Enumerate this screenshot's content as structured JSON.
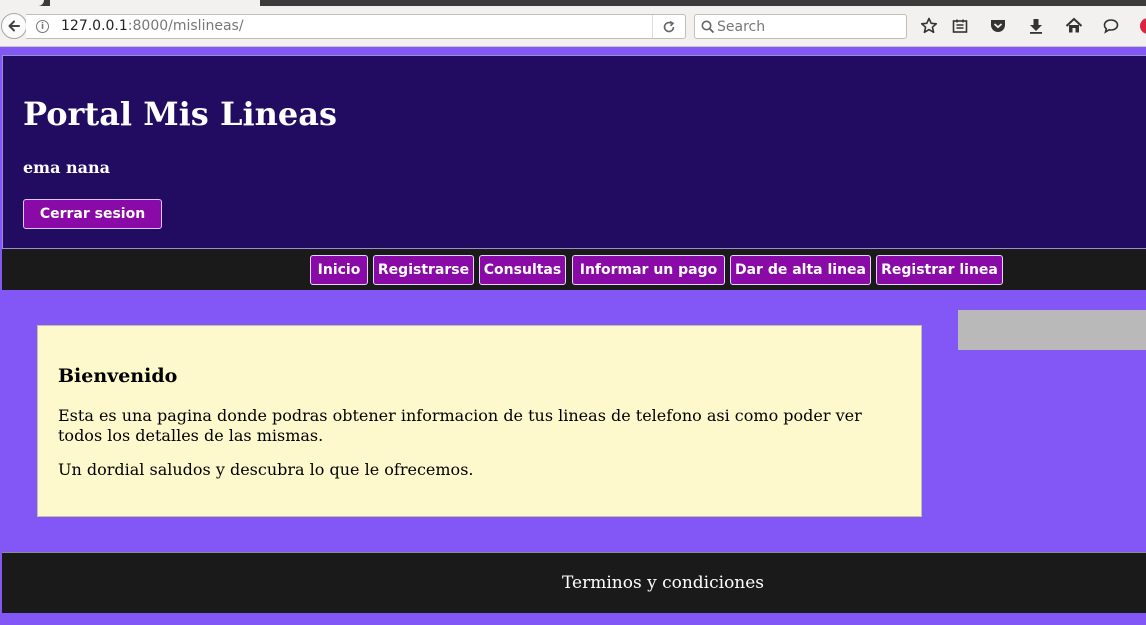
{
  "browser": {
    "url_host": "127.0.0.1",
    "url_rest": ":8000/mislineas/",
    "search_placeholder": "Search"
  },
  "header": {
    "title": "Portal Mis Lineas",
    "user": "ema nana",
    "logout_label": "Cerrar sesion"
  },
  "nav": {
    "items": [
      {
        "label": "Inicio"
      },
      {
        "label": "Registrarse"
      },
      {
        "label": "Consultas"
      },
      {
        "label": "Informar un pago"
      },
      {
        "label": "Dar de alta linea"
      },
      {
        "label": "Registrar linea"
      }
    ]
  },
  "content": {
    "title": "Bienvenido",
    "paragraph1": "Esta es una pagina donde podras obtener informacion de tus lineas de telefono asi como poder ver todos los detalles de las mismas.",
    "paragraph2": "Un dordial saludos y descubra lo que le ofrecemos."
  },
  "footer": {
    "link_label": "Terminos y condiciones"
  },
  "colors": {
    "page_background": "#8357f5",
    "header_background": "#220c62",
    "button_background": "#8a0aa7",
    "bar_background": "#1a1a1a",
    "content_background": "#fef9cd"
  },
  "icons": [
    "back-arrow-icon",
    "info-icon",
    "reload-icon",
    "search-icon",
    "bookmark-star-icon",
    "reading-list-icon",
    "pocket-icon",
    "download-icon",
    "home-icon",
    "chat-icon"
  ]
}
